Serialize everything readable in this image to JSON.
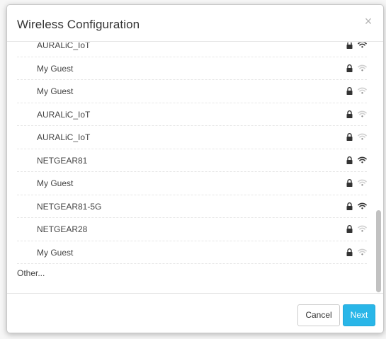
{
  "dialog": {
    "title": "Wireless Configuration",
    "close_glyph": "×"
  },
  "networks": [
    {
      "name": "AURALiC_IoT",
      "locked": true,
      "signal": "strong"
    },
    {
      "name": "My Guest",
      "locked": true,
      "signal": "weak"
    },
    {
      "name": "My Guest",
      "locked": true,
      "signal": "weak"
    },
    {
      "name": "AURALiC_IoT",
      "locked": true,
      "signal": "weak"
    },
    {
      "name": "AURALiC_IoT",
      "locked": true,
      "signal": "weak"
    },
    {
      "name": "NETGEAR81",
      "locked": true,
      "signal": "strong"
    },
    {
      "name": "My Guest",
      "locked": true,
      "signal": "weak"
    },
    {
      "name": "NETGEAR81-5G",
      "locked": true,
      "signal": "strong"
    },
    {
      "name": "NETGEAR28",
      "locked": true,
      "signal": "weak"
    },
    {
      "name": "My Guest",
      "locked": true,
      "signal": "weak"
    }
  ],
  "other_label": "Other...",
  "footer": {
    "cancel_label": "Cancel",
    "next_label": "Next"
  },
  "colors": {
    "accent": "#29b6e8",
    "icon_dark": "#333333",
    "icon_light": "#d0d0d0"
  },
  "icons": {
    "lock": "lock-icon",
    "wifi": "wifi-icon",
    "close": "close-icon"
  }
}
